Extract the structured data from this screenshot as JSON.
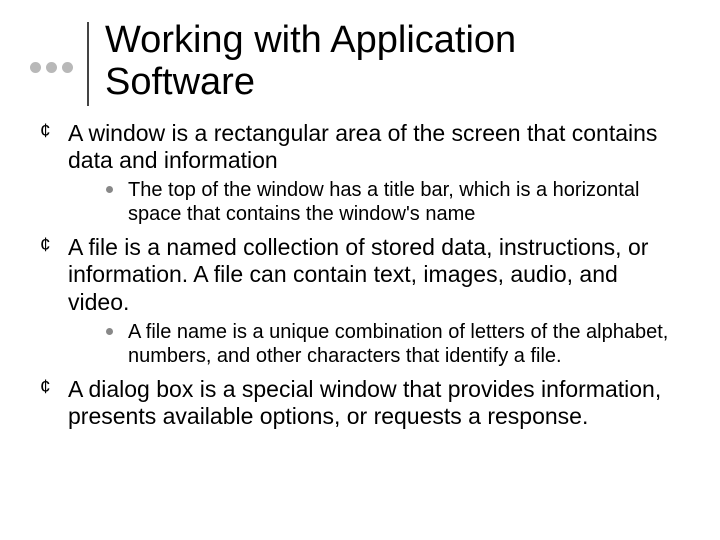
{
  "title": "Working with Application Software",
  "bullets": [
    {
      "text": "A window is a rectangular area of the screen that contains data and information",
      "sub": [
        "The top of the window has a title bar, which is a horizontal space that contains the window's name"
      ]
    },
    {
      "text": "A file is a named collection of stored data, instructions, or information. A file can contain text, images, audio, and video.",
      "sub": [
        "A file name is a unique combination of letters of the alphabet, numbers, and other characters that identify a file."
      ]
    },
    {
      "text": "A dialog box is a special window that provides information, presents available options, or requests a response.",
      "sub": []
    }
  ]
}
